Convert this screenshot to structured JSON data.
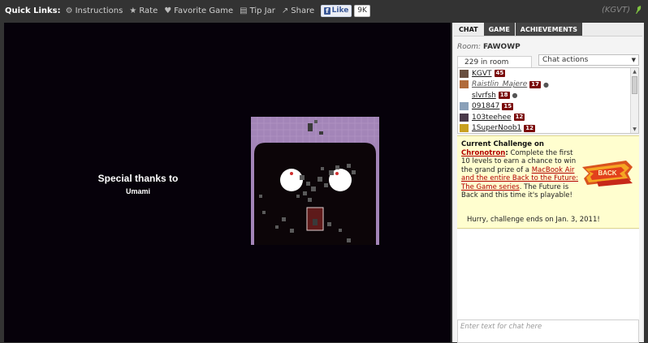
{
  "topbar": {
    "title": "Quick Links:",
    "links": [
      {
        "label": "Instructions",
        "icon": "gear-icon"
      },
      {
        "label": "Rate",
        "icon": "star-icon"
      },
      {
        "label": "Favorite Game",
        "icon": "heart-icon"
      },
      {
        "label": "Tip Jar",
        "icon": "tip-jar-icon"
      },
      {
        "label": "Share",
        "icon": "share-icon"
      }
    ],
    "fb_like_label": "Like",
    "fb_like_count": "9K",
    "username": "(KGVT)"
  },
  "game": {
    "credits_title": "Special thanks to",
    "credits_name": "Umami"
  },
  "panel": {
    "tabs": [
      "CHAT",
      "GAME",
      "ACHIEVEMENTS"
    ],
    "active_tab": "CHAT",
    "room_label": "Room:",
    "room_name": "FAWOWP",
    "room_count": "229 in room",
    "chat_actions": "Chat actions",
    "users": [
      {
        "name": "KGVT",
        "level": "45",
        "moderator": false,
        "person": false
      },
      {
        "name": "Raistlin_Majere",
        "level": "17",
        "moderator": true,
        "person": true
      },
      {
        "name": "slvrfsh",
        "level": "18",
        "moderator": false,
        "person": true
      },
      {
        "name": "091847",
        "level": "15",
        "moderator": false,
        "person": false
      },
      {
        "name": "103teehee",
        "level": "12",
        "moderator": false,
        "person": false
      },
      {
        "name": "1SuperNoob1",
        "level": "12",
        "moderator": false,
        "person": false
      }
    ],
    "challenge": {
      "heading": "Current Challenge on",
      "game_link": "Chronotron",
      "heading_suffix": ":",
      "line1": "Complete the first 10 levels to earn a chance to win the grand prize of a",
      "prize_link": "MacBook Air and the entire Back to the Future: The Game series",
      "line2": ". The Future is Back and this time it's playable!",
      "ends": "Hurry, challenge ends on Jan. 3, 2011!"
    },
    "chat_input_placeholder": "Enter text for chat here"
  },
  "colors": {
    "topbar_bg": "#333333",
    "game_bg": "#06010a",
    "level_badge": "#7a0a0a",
    "challenge_bg": "#fffecf",
    "link_red": "#b30000",
    "scene_wall": "#a385b8"
  }
}
